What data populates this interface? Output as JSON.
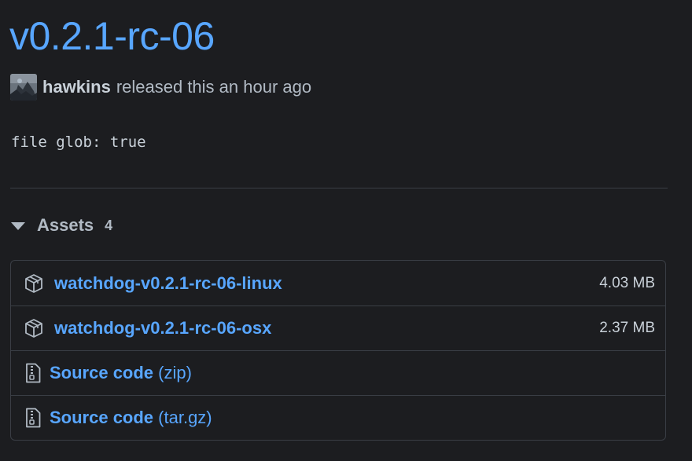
{
  "release": {
    "title": "v0.2.1-rc-06",
    "author": "hawkins",
    "released_text": "released this an hour ago",
    "notes": "file glob: true"
  },
  "assets": {
    "label": "Assets",
    "count": "4",
    "files": [
      {
        "name": "watchdog-v0.2.1-rc-06-linux",
        "size": "4.03 MB",
        "icon": "package-icon"
      },
      {
        "name": "watchdog-v0.2.1-rc-06-osx",
        "size": "2.37 MB",
        "icon": "package-icon"
      }
    ],
    "source": [
      {
        "label": "Source code",
        "format": "(zip)",
        "icon": "file-zip-icon"
      },
      {
        "label": "Source code",
        "format": "(tar.gz)",
        "icon": "file-zip-icon"
      }
    ]
  },
  "colors": {
    "background": "#1c1d20",
    "link": "#58a6ff",
    "text": "#c9d1d9",
    "muted": "#b1bac4",
    "border": "#3a3e45"
  }
}
